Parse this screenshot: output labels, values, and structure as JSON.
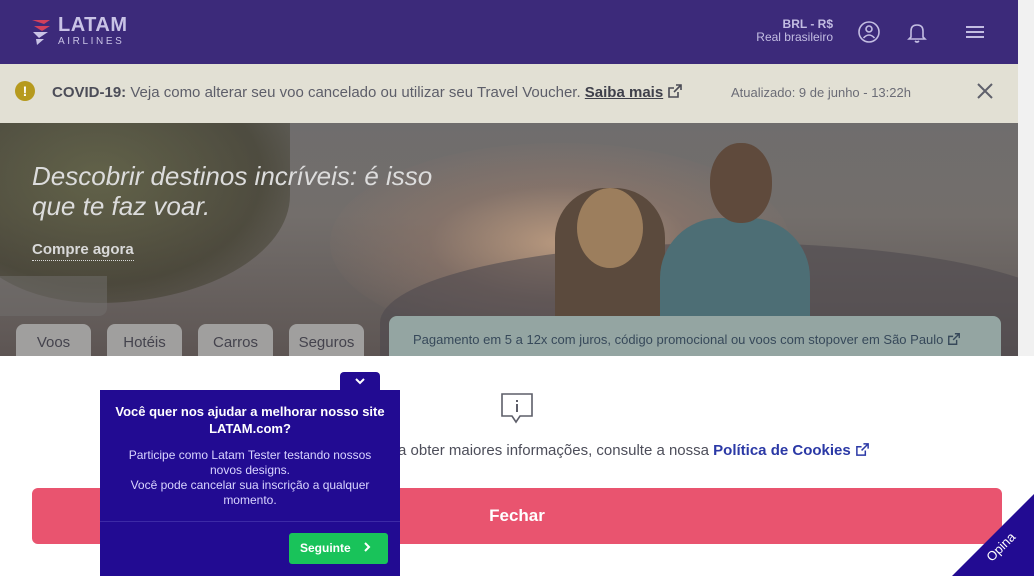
{
  "header": {
    "brand_name": "LATAM",
    "brand_sub": "AIRLINES",
    "currency_code": "BRL - R$",
    "currency_name": "Real brasileiro",
    "colors": {
      "background": "#3c2a7a",
      "brand": "#c9c3e6"
    }
  },
  "covid_banner": {
    "label": "COVID-19:",
    "message": "Veja como alterar seu voo cancelado ou utilizar seu Travel Voucher.",
    "link": "Saiba mais",
    "updated": "Atualizado: 9 de junho - 13:22h"
  },
  "hero": {
    "title": "Descobrir destinos incríveis: é isso que te faz voar.",
    "cta": "Compre agora"
  },
  "tabs": [
    {
      "label": "Voos"
    },
    {
      "label": "Hotéis"
    },
    {
      "label": "Carros"
    },
    {
      "label": "Seguros"
    }
  ],
  "promo": {
    "text": "Pagamento em 5 a 12x com juros, código promocional ou voos com stopover em São Paulo"
  },
  "cookie_notice": {
    "text_visible": "a obter maiores informações, consulte a nossa",
    "policy_link": "Política de Cookies",
    "close_button": "Fechar"
  },
  "survey": {
    "title": "Você quer nos ajudar a melhorar nosso site LATAM.com?",
    "body_line1": "Participe como Latam Tester testando nossos novos designs.",
    "body_line2": "Você pode cancelar sua inscrição a qualquer momento.",
    "next_button": "Seguinte",
    "colors": {
      "background": "#220b92",
      "button": "#19c35a"
    }
  },
  "feedback_tab": {
    "label": "Opina"
  }
}
